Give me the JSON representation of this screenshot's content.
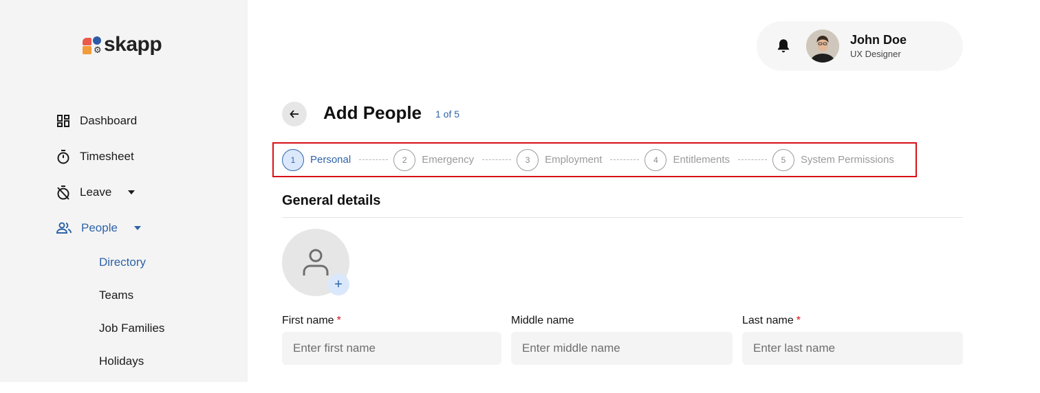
{
  "app": {
    "logo_text": "skapp"
  },
  "sidebar": {
    "items": [
      {
        "label": "Dashboard",
        "icon": "dashboard-icon"
      },
      {
        "label": "Timesheet",
        "icon": "stopwatch-icon"
      },
      {
        "label": "Leave",
        "icon": "leave-icon"
      },
      {
        "label": "People",
        "icon": "people-icon"
      }
    ],
    "people_subitems": [
      "Directory",
      "Teams",
      "Job Families",
      "Holidays"
    ]
  },
  "user": {
    "name": "John Doe",
    "role": "UX Designer"
  },
  "page": {
    "title": "Add People",
    "step_count": "1 of 5"
  },
  "steps": [
    {
      "number": "1",
      "label": "Personal"
    },
    {
      "number": "2",
      "label": "Emergency"
    },
    {
      "number": "3",
      "label": "Employment"
    },
    {
      "number": "4",
      "label": "Entitlements"
    },
    {
      "number": "5",
      "label": "System Permissions"
    }
  ],
  "form": {
    "section_title": "General details",
    "first_name": {
      "label": "First name",
      "required": "*",
      "placeholder": "Enter first name"
    },
    "middle_name": {
      "label": "Middle name",
      "placeholder": "Enter middle name"
    },
    "last_name": {
      "label": "Last name",
      "required": "*",
      "placeholder": "Enter last name"
    },
    "photo_add": "+"
  },
  "colors": {
    "accent": "#2e63a8",
    "highlight_border": "#d80f16",
    "sidebar_bg": "#f4f4f4"
  }
}
